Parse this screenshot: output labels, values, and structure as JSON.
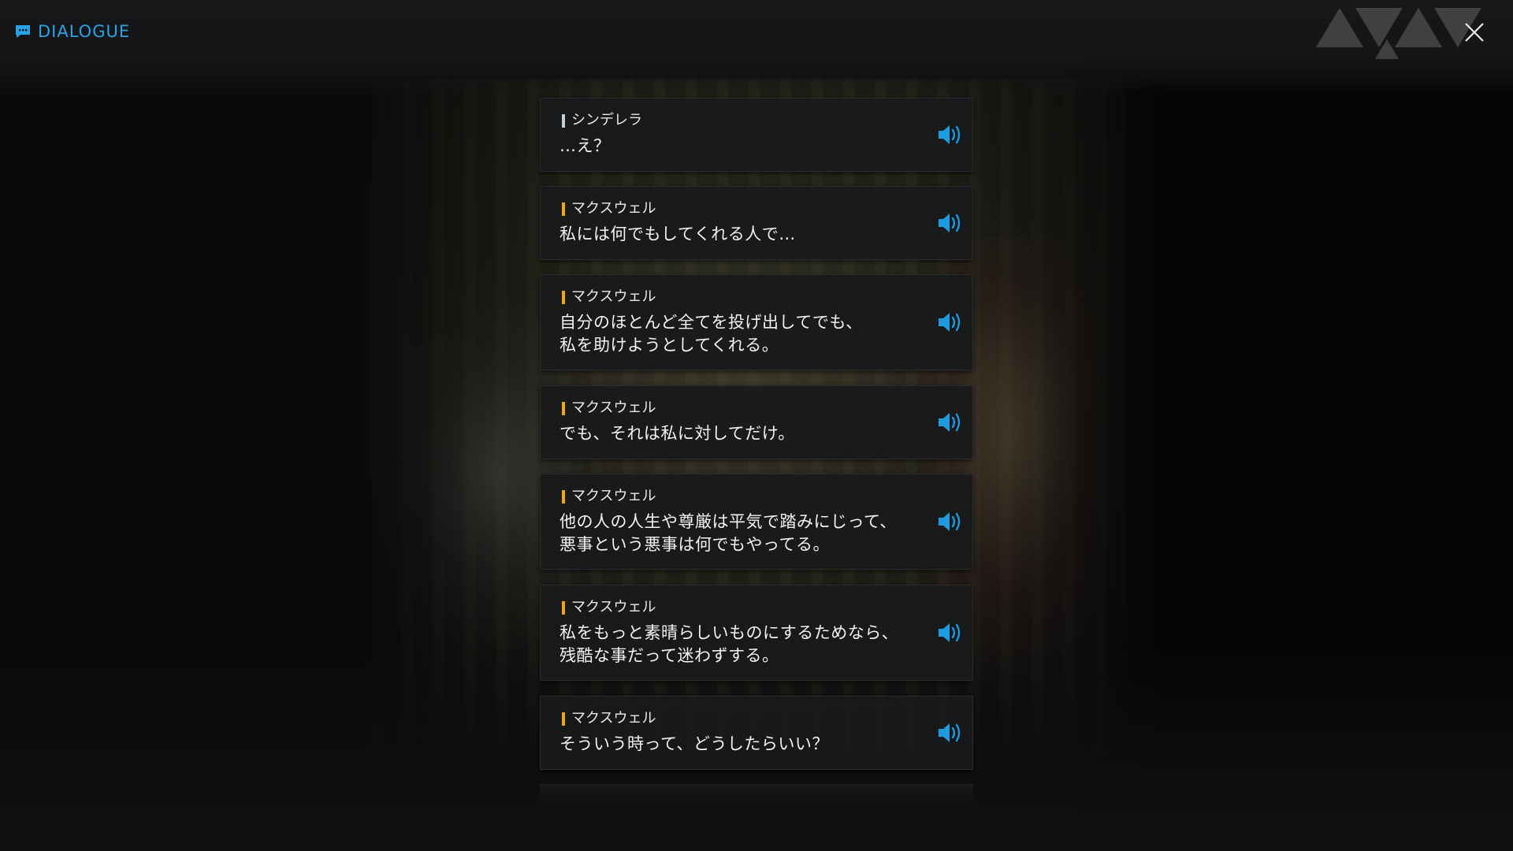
{
  "header": {
    "title": "DIALOGUE",
    "title_icon": "chat-bubble-icon",
    "close_icon": "close-icon"
  },
  "colors": {
    "accent": "#2aa3e6",
    "speaker_bar_cinderella": "#c9ccd2",
    "speaker_bar_maxwell": "#f0a418",
    "voice_icon": "#1d9ae0"
  },
  "dialogue": [
    {
      "speaker": "シンデレラ",
      "text": "…え？",
      "voice_icon": "speaker-volume-icon"
    },
    {
      "speaker": "マクスウェル",
      "text": "私には何でもしてくれる人で…",
      "voice_icon": "speaker-volume-icon"
    },
    {
      "speaker": "マクスウェル",
      "text": "自分のほとんど全てを投げ出してでも、\n私を助けようとしてくれる。",
      "voice_icon": "speaker-volume-icon"
    },
    {
      "speaker": "マクスウェル",
      "text": "でも、それは私に対してだけ。",
      "voice_icon": "speaker-volume-icon"
    },
    {
      "speaker": "マクスウェル",
      "text": "他の人の人生や尊厳は平気で踏みにじって、\n悪事という悪事は何でもやってる。",
      "voice_icon": "speaker-volume-icon"
    },
    {
      "speaker": "マクスウェル",
      "text": "私をもっと素晴らしいものにするためなら、\n残酷な事だって迷わずする。",
      "voice_icon": "speaker-volume-icon"
    },
    {
      "speaker": "マクスウェル",
      "text": "そういう時って、どうしたらいい？",
      "voice_icon": "speaker-volume-icon"
    }
  ]
}
